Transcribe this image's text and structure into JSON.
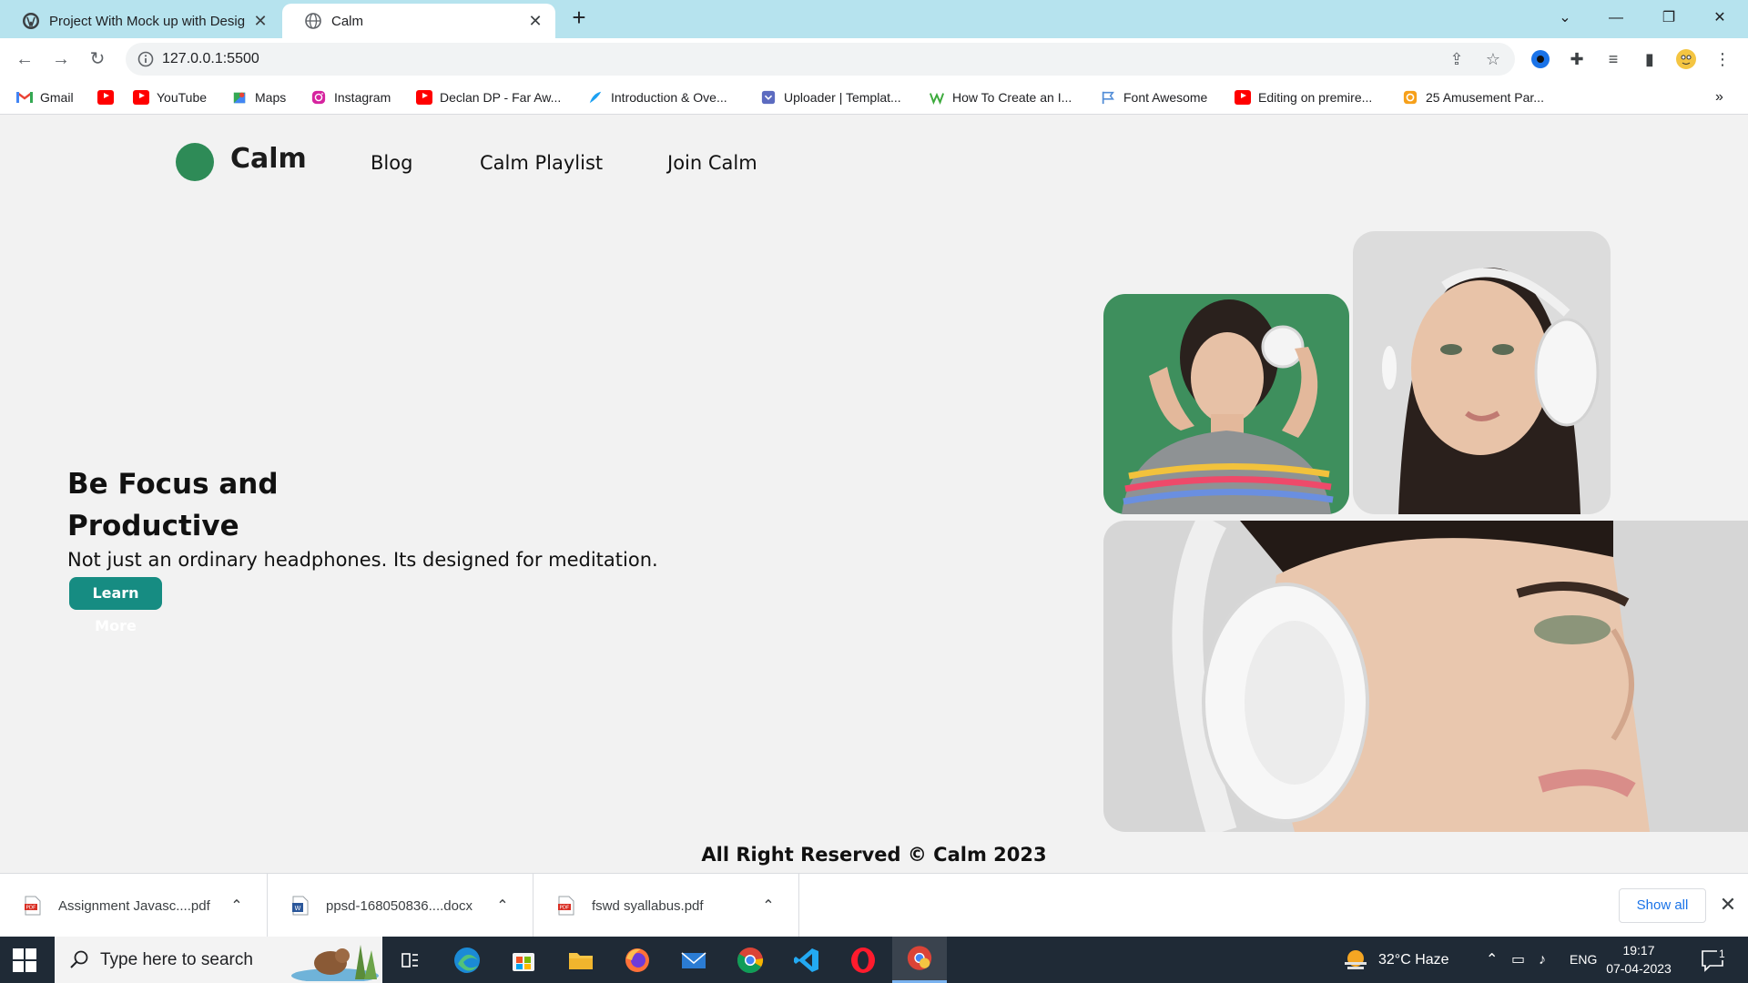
{
  "browser": {
    "tabs": [
      {
        "title": "Project With Mock up with Desig",
        "active": false
      },
      {
        "title": "Calm",
        "active": true
      }
    ],
    "url": "127.0.0.1:5500",
    "bookmarks": [
      {
        "label": "Gmail",
        "icon": "gmail-icon"
      },
      {
        "label": "",
        "icon": "youtube-icon"
      },
      {
        "label": "YouTube",
        "icon": "youtube-icon"
      },
      {
        "label": "Maps",
        "icon": "maps-icon"
      },
      {
        "label": "Instagram",
        "icon": "instagram-icon"
      },
      {
        "label": "Declan DP - Far Aw...",
        "icon": "youtube-icon"
      },
      {
        "label": "Introduction & Ove...",
        "icon": "feather-icon"
      },
      {
        "label": "Uploader | Templat...",
        "icon": "uploader-icon"
      },
      {
        "label": "How To Create an I...",
        "icon": "w-icon"
      },
      {
        "label": "Font Awesome",
        "icon": "flag-icon"
      },
      {
        "label": "Editing on premire...",
        "icon": "youtube-icon"
      },
      {
        "label": "25 Amusement Par...",
        "icon": "amusement-icon"
      }
    ],
    "more_bookmarks": "»"
  },
  "site": {
    "logo": "Calm",
    "nav": [
      "Blog",
      "Calm Playlist",
      "Join Calm"
    ],
    "hero_title": "Be Focus and Productive",
    "hero_subtitle": "Not just an ordinary headphones. Its designed for meditation.",
    "cta": "Learn More",
    "footer": "All Right Reserved © Calm 2023",
    "accent_color": "#168c82",
    "logo_color": "#2e8b57"
  },
  "downloads": {
    "items": [
      {
        "name": "Assignment Javasc....pdf",
        "type": "pdf"
      },
      {
        "name": "ppsd-168050836....docx",
        "type": "docx"
      },
      {
        "name": "fswd syallabus.pdf",
        "type": "pdf"
      }
    ],
    "show_all": "Show all"
  },
  "taskbar": {
    "search_placeholder": "Type here to search",
    "weather": "32°C  Haze",
    "language": "ENG",
    "time": "19:17",
    "date": "07-04-2023",
    "notifications": "1"
  }
}
